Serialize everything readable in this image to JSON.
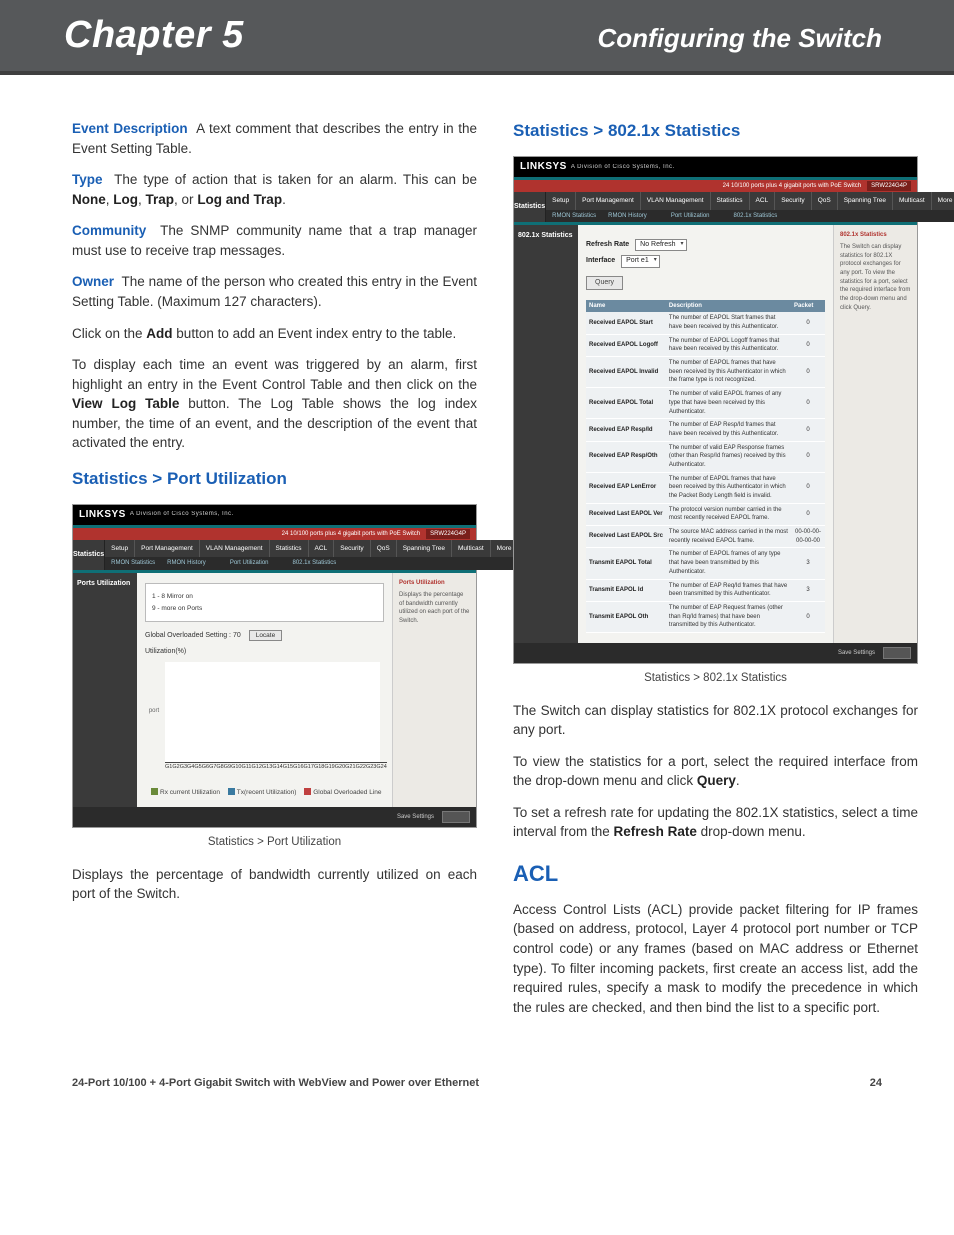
{
  "header": {
    "chapter": "Chapter 5",
    "title": "Configuring the Switch"
  },
  "footer": {
    "product": "24-Port 10/100 + 4-Port Gigabit Switch with WebView and Power over Ethernet",
    "page": "24"
  },
  "left": {
    "defs": [
      {
        "term": "Event Description",
        "text": "A text comment that describes the entry in the Event Setting Table."
      },
      {
        "term": "Type",
        "text": "The type of action that is taken for an alarm. This can be ",
        "bold_list": "None, Log, Trap, or Log and Trap",
        "tail": "."
      },
      {
        "term": "Community",
        "text": "The SNMP community name that a trap manager must use to receive trap messages."
      },
      {
        "term": "Owner",
        "text": "The name of the person who created this entry in the Event Setting Table. (Maximum 127 characters)."
      }
    ],
    "p_add": {
      "pre": "Click on the ",
      "b": "Add",
      "post": " button to add an Event index entry to the table."
    },
    "p_view": {
      "pre": "To display each time an event was triggered by an alarm, first highlight an entry in the Event Control Table and then click on the ",
      "b": "View Log Table",
      "post": " button. The Log Table shows the log index number, the time of an event, and the description of the event that activated the entry."
    },
    "h_port": "Statistics > Port Utilization",
    "fig1_caption": "Statistics > Port Utilization",
    "p_port": "Displays the percentage of bandwidth currently utilized on each port of the Switch."
  },
  "right": {
    "h_8021x": "Statistics > 802.1x Statistics",
    "fig2_caption": "Statistics > 802.1x Statistics",
    "p1": "The Switch can display statistics for 802.1X protocol exchanges for any port.",
    "p2": {
      "pre": "To view the statistics for a port, select the required interface from the drop-down menu and click ",
      "b": "Query",
      "post": "."
    },
    "p3": {
      "pre": "To set a refresh rate for updating the 802.1X statistics, select a time interval from the ",
      "b": "Refresh Rate",
      "post": " drop-down menu."
    },
    "h_acl": "ACL",
    "p_acl": "Access Control Lists (ACL) provide packet filtering for IP frames (based on address, protocol, Layer 4 protocol port number or TCP control code) or any frames (based on MAC address or Ethernet type). To filter incoming packets, first create an access list, add the required rules, specify a mask to modify the precedence in which the rules are checked, and then bind the list to a specific port."
  },
  "shot_common": {
    "brand": "LINKSYS",
    "brand_sub": "A Division of Cisco Systems, Inc.",
    "redbar_text": "24 10/100 ports plus 4 gigabit ports with PoE Switch",
    "model": "SRW224G4P",
    "tabs": [
      "Setup",
      "Port Management",
      "VLAN Management",
      "Statistics",
      "ACL",
      "Security",
      "QoS",
      "Spanning Tree",
      "Multicast",
      "More >>"
    ]
  },
  "shot_port": {
    "section": "Statistics",
    "side": "Ports Utilization",
    "subtabs": [
      "RMON Statistics",
      "RMON History",
      "",
      "Port Utilization",
      "",
      "802.1x Statistics"
    ],
    "box_lines": [
      "1 - 8  Mirror on",
      "9 - more on Ports"
    ],
    "slider_label": "Global Overloaded Setting :",
    "slider_val": "70",
    "slider_btn": "Locate",
    "util_label": "Utilization(%)",
    "legend": [
      "Rx current Utilization",
      "Tx(recent Utilization)",
      "Global Overloaded Line"
    ],
    "help_title": "Ports Utilization",
    "help_text": "Displays the percentage of bandwidth currently utilized on each port of the Switch.",
    "chart_ports": [
      "G1",
      "G2",
      "G3",
      "G4",
      "G5",
      "G6",
      "G7",
      "G8",
      "G9",
      "G10",
      "G11",
      "G12",
      "G13",
      "G14",
      "G15",
      "G16",
      "G17",
      "G18",
      "G19",
      "G20",
      "G21",
      "G22",
      "G23",
      "G24"
    ]
  },
  "shot_8021x": {
    "section": "Statistics",
    "side": "802.1x Statistics",
    "subtabs": [
      "RMON Statistics",
      "RMON History",
      "",
      "Port Utilization",
      "",
      "802.1x Statistics"
    ],
    "refresh_label": "Refresh Rate",
    "refresh_val": "No Refresh",
    "iface_label": "Interface",
    "iface_val": "Port e1",
    "query": "Query",
    "help_title": "802.1x Statistics",
    "help_text": "The Switch can display statistics for 802.1X protocol exchanges for any port. To view the statistics for a port, select the required interface from the drop-down menu and click Query.",
    "th": [
      "Name",
      "Description",
      "Packet"
    ],
    "rows": [
      [
        "Received EAPOL Start",
        "The number of EAPOL Start frames that have been received by this Authenticator.",
        "0"
      ],
      [
        "Received EAPOL Logoff",
        "The number of EAPOL Logoff frames that have been received by this Authenticator.",
        "0"
      ],
      [
        "Received EAPOL Invalid",
        "The number of EAPOL frames that have been received by this Authenticator in which the frame type is not recognized.",
        "0"
      ],
      [
        "Received EAPOL Total",
        "The number of valid EAPOL frames of any type that have been received by this Authenticator.",
        "0"
      ],
      [
        "Received EAP Resp/Id",
        "The number of EAP Resp/Id frames that have been received by this Authenticator.",
        "0"
      ],
      [
        "Received EAP Resp/Oth",
        "The number of valid EAP Response frames (other than Resp/Id frames) received by this Authenticator.",
        "0"
      ],
      [
        "Received EAP LenError",
        "The number of EAPOL frames that have been received by this Authenticator in which the Packet Body Length field is invalid.",
        "0"
      ],
      [
        "Received Last EAPOL Ver",
        "The protocol version number carried in the most recently received EAPOL frame.",
        "0"
      ],
      [
        "Received Last EAPOL Src",
        "The source MAC address carried in the most recently received EAPOL frame.",
        "00-00-00-00-00-00"
      ],
      [
        "Transmit EAPOL Total",
        "The number of EAPOL frames of any type that have been transmitted by this Authenticator.",
        "3"
      ],
      [
        "Transmit EAPOL Id",
        "The number of EAP Req/Id frames that have been transmitted by this Authenticator.",
        "3"
      ],
      [
        "Transmit EAPOL Oth",
        "The number of EAP Request frames (other than Rq/Id frames) that have been transmitted by this Authenticator.",
        "0"
      ]
    ]
  }
}
